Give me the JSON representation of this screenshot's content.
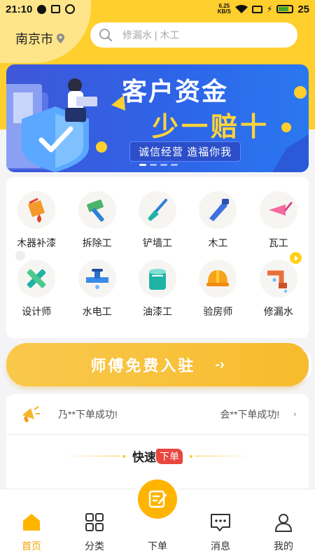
{
  "status_bar": {
    "time": "21:10",
    "speed": "6.25",
    "speed_unit": "KB/S",
    "battery": "25"
  },
  "header": {
    "city": "南京市",
    "search_placeholder": "修漏水 | 木工"
  },
  "banner": {
    "title": "客户资金",
    "subtitle": "少一赔十",
    "slogan": "诚信经营 造福你我",
    "slide_count": 4,
    "active_slide": 1
  },
  "categories": [
    {
      "label": "木器补漆",
      "icon": "paint-bucket-icon"
    },
    {
      "label": "拆除工",
      "icon": "hammer-icon"
    },
    {
      "label": "铲墙工",
      "icon": "shovel-icon"
    },
    {
      "label": "木工",
      "icon": "saw-icon"
    },
    {
      "label": "瓦工",
      "icon": "trowel-icon"
    },
    {
      "label": "设计师",
      "icon": "ruler-pencil-icon"
    },
    {
      "label": "水电工",
      "icon": "faucet-icon"
    },
    {
      "label": "油漆工",
      "icon": "paint-can-icon"
    },
    {
      "label": "验房师",
      "icon": "hard-hat-icon"
    },
    {
      "label": "修漏水",
      "icon": "leaking-pipe-icon"
    }
  ],
  "join_button": {
    "label": "师傅免费入驻",
    "arrow": "-›"
  },
  "ticker": {
    "item1": "乃**下单成功!",
    "item2": "会**下单成功!",
    "arrow": "›"
  },
  "quick_order": {
    "title": "快速",
    "tag": "下单"
  },
  "bottom_nav": [
    {
      "label": "首页",
      "icon": "home-icon",
      "active": true
    },
    {
      "label": "分类",
      "icon": "grid-icon"
    },
    {
      "label": "下单",
      "icon": "order-edit-icon"
    },
    {
      "label": "消息",
      "icon": "message-icon"
    },
    {
      "label": "我的",
      "icon": "profile-icon"
    }
  ],
  "colors": {
    "brand_yellow": "#ffcf2e",
    "accent_orange": "#f5a400",
    "banner_blue": "#2e64e8",
    "tag_red": "#e9463f"
  }
}
